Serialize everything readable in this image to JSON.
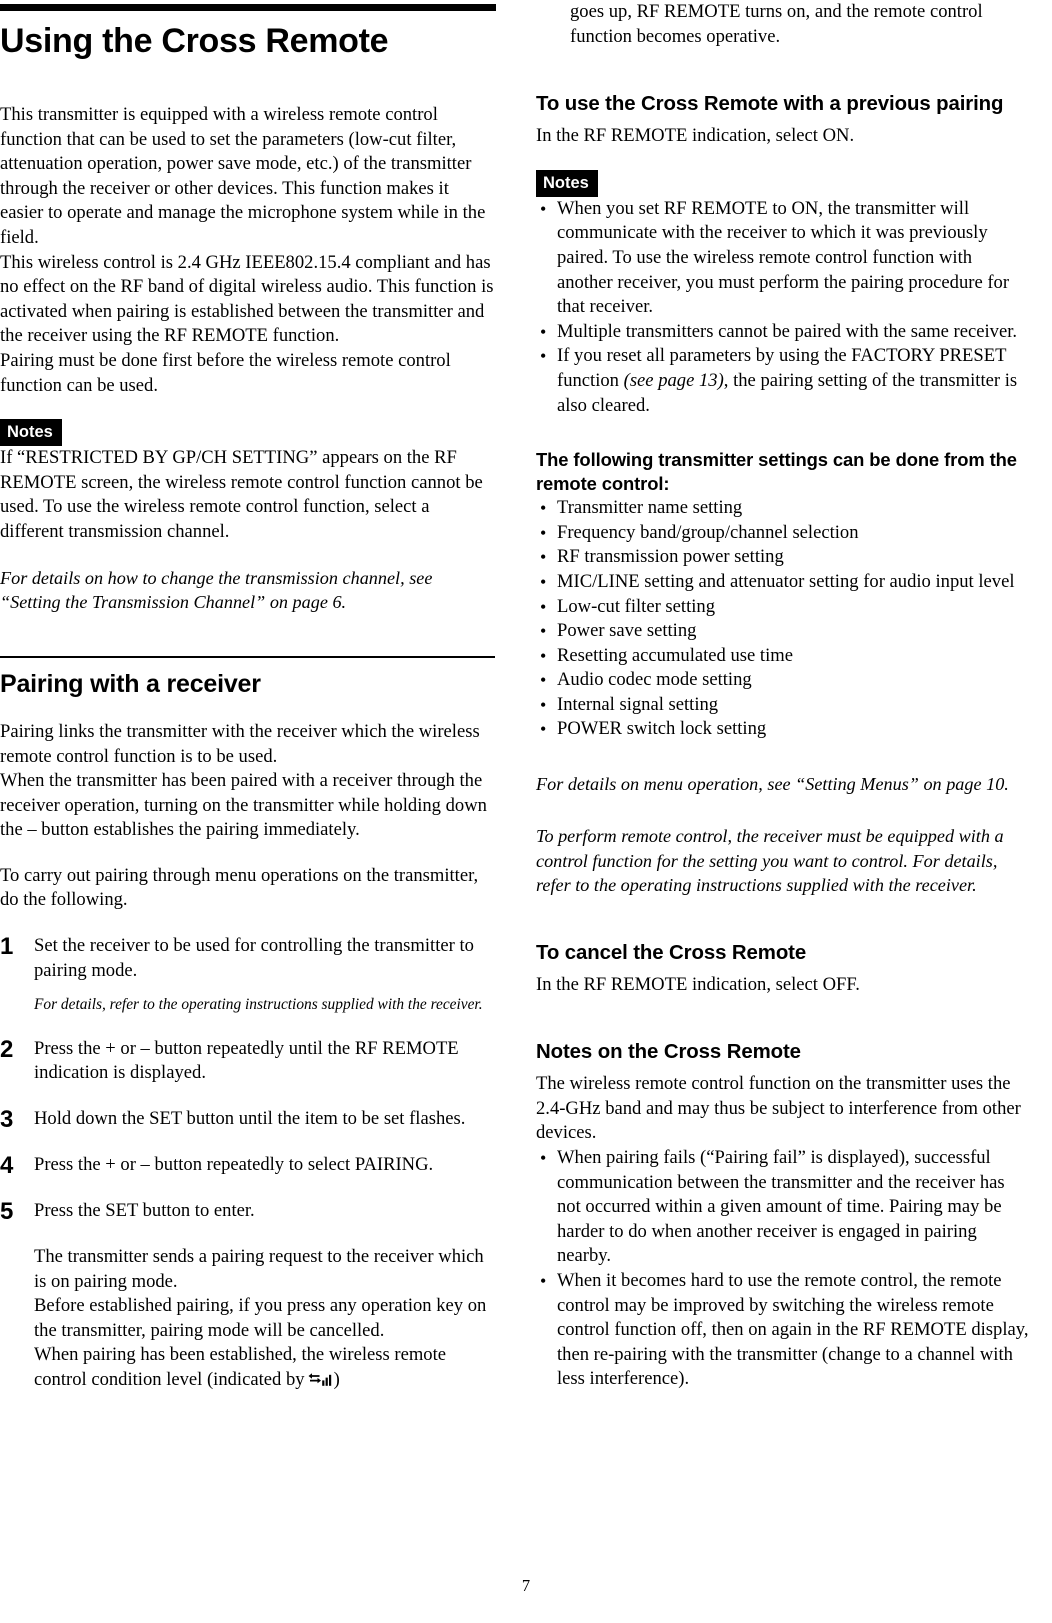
{
  "document": {
    "page_number": "7",
    "chapter_title": "Using the Cross Remote"
  },
  "left_column": {
    "intro_paragraph_1": "This transmitter is equipped with a wireless remote control function that can be used to set the parameters (low-cut filter, attenuation operation, power save mode, etc.) of the transmitter through the receiver or other devices. This function makes it easier to operate and manage the microphone system while in the field.",
    "intro_paragraph_2": "This wireless control is 2.4 GHz IEEE802.15.4 compliant and has no effect on the RF band of digital wireless audio. This function is activated when pairing is established between the transmitter and the receiver using the RF REMOTE function.",
    "intro_paragraph_3": "Pairing must be done first before the wireless remote control function can be used.",
    "notes_badge": "Notes",
    "notes_text": "If “RESTRICTED BY GP/CH SETTING” appears on the RF REMOTE screen, the wireless remote control function cannot be used. To use the wireless remote control function, select a different transmission channel.",
    "reference_note": "For details on how to change the transmission channel, see “Setting the Transmission Channel” on page 6.",
    "section_title": "Pairing with a receiver",
    "pairing_paragraph_1": "Pairing links the transmitter with the receiver which the wireless remote control function is to be used.",
    "pairing_paragraph_2": "When the transmitter has been paired with a receiver through the receiver operation, turning on the transmitter while holding down the – button establishes the pairing immediately.",
    "pairing_paragraph_3": "To carry out pairing through menu operations on the transmitter, do the following.",
    "steps": [
      {
        "number": "1",
        "text": "Set the receiver to be used for controlling the transmitter to pairing mode.",
        "sub_note": "For details, refer to the operating instructions supplied with the receiver."
      },
      {
        "number": "2",
        "text": "Press the + or – button repeatedly until the RF REMOTE indication is displayed.",
        "sub_note": ""
      },
      {
        "number": "3",
        "text": "Hold down the SET button until the item to be set flashes.",
        "sub_note": ""
      },
      {
        "number": "4",
        "text": "Press the + or – button repeatedly to select PAIRING.",
        "sub_note": ""
      },
      {
        "number": "5",
        "text": "Press the SET button to enter.",
        "sub_note": ""
      }
    ],
    "step5_result_line1": "The transmitter sends a pairing request to the receiver which is on pairing mode.",
    "step5_result_line2": "Before established pairing, if you press any operation key on the transmitter, pairing mode will be cancelled.",
    "step5_result_line3_before_icon": "When pairing has been established, the wireless remote control condition level (indicated by",
    "step5_result_line3_after_icon": ")",
    "signal_icon_name": "rf-remote-signal-level-icon"
  },
  "right_column": {
    "continuation_text": "goes up, RF REMOTE turns on, and the remote control function becomes operative.",
    "previous_pairing_title": "To use the Cross Remote with a previous pairing",
    "previous_pairing_text": "In the RF REMOTE indication, select ON.",
    "notes_badge": "Notes",
    "notes_bullets": [
      "When you set RF REMOTE to ON, the transmitter will communicate with the receiver to which it was previously paired. To use the wireless remote control function with another receiver, you must perform the pairing procedure for that receiver.",
      "Multiple transmitters cannot be paired with the same receiver."
    ],
    "notes_bullet_factory_preset_part1": "If you reset all parameters by using the FACTORY PRESET function ",
    "notes_bullet_factory_preset_italic": "(see page 13)",
    "notes_bullet_factory_preset_part2": ", the pairing setting of the transmitter is also cleared.",
    "settings_list_title": "The following transmitter settings can be done from the remote control:",
    "settings_list": [
      "Transmitter name setting",
      "Frequency band/group/channel selection",
      "RF transmission power setting",
      "MIC/LINE setting and attenuator setting for audio input level",
      "Low-cut filter setting",
      "Power save setting",
      "Resetting accumulated use time",
      "Audio codec mode setting",
      "Internal signal setting",
      "POWER switch lock setting"
    ],
    "menu_reference": "For details on menu operation, see “Setting Menus” on page 10.",
    "remote_control_reference": "To perform remote control, the receiver must be equipped with a control function for the setting you want to control. For details, refer to the operating instructions supplied with the receiver.",
    "cancel_title": "To cancel the Cross Remote",
    "cancel_text": "In the RF REMOTE indication, select OFF.",
    "notes_on_cross_remote_title": "Notes on the Cross Remote",
    "notes_on_cross_remote_intro": "The wireless remote control function on the transmitter uses the 2.4-GHz band and may thus be subject to interference from other devices.",
    "notes_on_cross_remote_bullets": [
      "When pairing fails (“Pairing fail” is displayed), successful communication between the transmitter and the receiver has not occurred within a given amount of time. Pairing may be harder to do when another receiver is engaged in pairing nearby.",
      "When it becomes hard to use the remote control, the remote control may be improved by switching the wireless remote control function off, then on again in the RF REMOTE display, then re-pairing with the transmitter (change to a channel with less interference)."
    ]
  },
  "colors": {
    "text": "#000000",
    "background": "#ffffff",
    "badge_background": "#000000",
    "badge_text": "#ffffff"
  }
}
